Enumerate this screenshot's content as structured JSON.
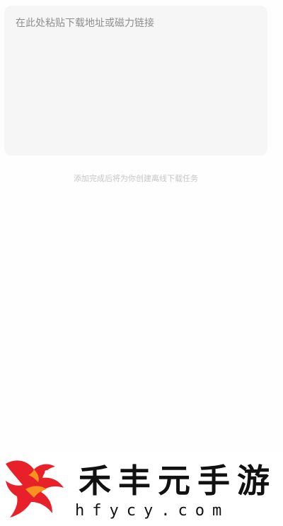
{
  "input": {
    "placeholder": "在此处粘贴下载地址或磁力链接",
    "value": ""
  },
  "hint": "添加完成后将为你创建离线下载任务",
  "watermark": {
    "brand_chars": [
      "禾",
      "丰",
      "元",
      "手",
      "游"
    ],
    "domain": "hfycy.com"
  },
  "colors": {
    "input_bg": "#f6f6f6",
    "placeholder": "#8e8e8e",
    "hint": "#c6c6c6",
    "logo_red": "#e8202a",
    "logo_orange": "#f7931e"
  }
}
